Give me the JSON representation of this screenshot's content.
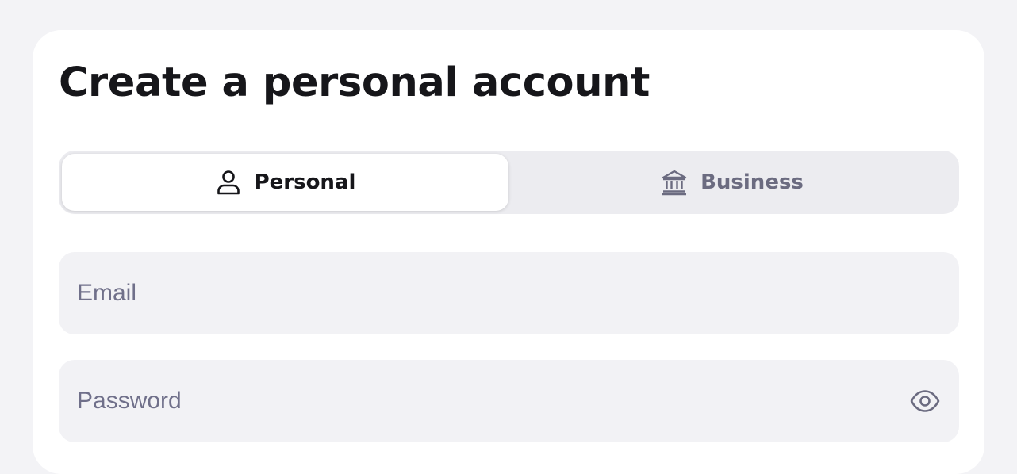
{
  "page": {
    "title": "Create a personal account"
  },
  "account_type": {
    "options": [
      {
        "label": "Personal",
        "icon": "user-icon",
        "selected": true
      },
      {
        "label": "Business",
        "icon": "bank-icon",
        "selected": false
      }
    ]
  },
  "form": {
    "email": {
      "placeholder": "Email",
      "value": ""
    },
    "password": {
      "placeholder": "Password",
      "value": "",
      "toggle_icon": "eye-icon"
    }
  },
  "colors": {
    "background": "#f3f3f6",
    "card": "#ffffff",
    "text_primary": "#16161a",
    "text_muted": "#6b6b80",
    "segment_track": "#ececf0",
    "field_bg": "#f2f2f5"
  }
}
